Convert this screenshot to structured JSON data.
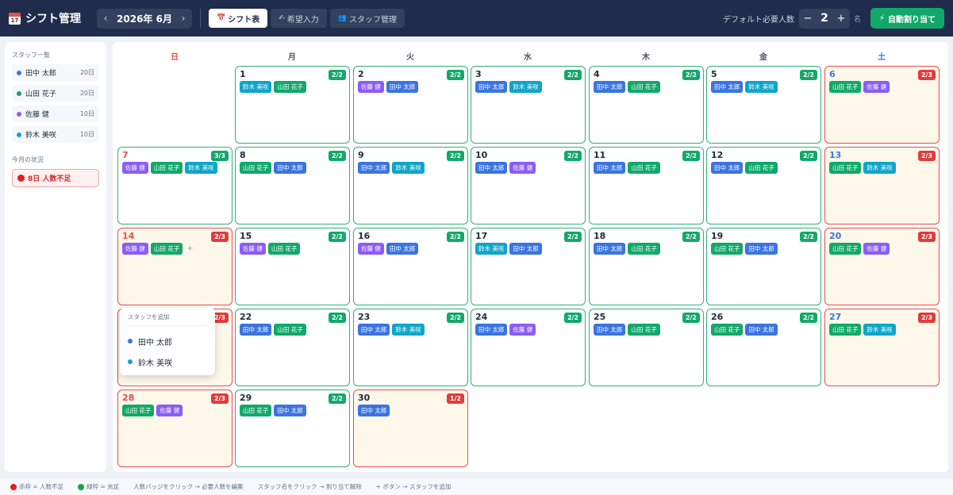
{
  "header": {
    "icon_text": "17",
    "title": "シフト管理",
    "month": "2026年 6月",
    "prev": "‹",
    "next": "›",
    "tabs": [
      {
        "icon": "📅",
        "label": "シフト表"
      },
      {
        "icon": "✍",
        "label": "希望入力"
      },
      {
        "icon": "👥",
        "label": "スタッフ管理"
      }
    ],
    "default_req_label": "デフォルト必要人数",
    "minus": "−",
    "plus": "+",
    "default_req_value": "2",
    "unit": "名",
    "auto_icon": "⚡",
    "auto_label": "自動割り当て"
  },
  "sidebar": {
    "staff_title": "スタッフ一覧",
    "staff": [
      {
        "name": "田中 太郎",
        "count": "20日",
        "color": "#3b74e0"
      },
      {
        "name": "山田 花子",
        "count": "20日",
        "color": "#12a86a"
      },
      {
        "name": "佐藤 健",
        "count": "10日",
        "color": "#8b5cf6"
      },
      {
        "name": "鈴木 美咲",
        "count": "10日",
        "color": "#0ea5c9"
      }
    ],
    "status_title": "今月の状況",
    "status_text": "8日 人数不足"
  },
  "weekdays": [
    "日",
    "月",
    "火",
    "水",
    "木",
    "金",
    "土"
  ],
  "days": [
    {
      "d": "1",
      "b": "2/2",
      "s": [
        "鈴木 美咲",
        "山田 花子"
      ]
    },
    {
      "d": "2",
      "b": "2/2",
      "s": [
        "佐藤 健",
        "田中 太郎"
      ]
    },
    {
      "d": "3",
      "b": "2/2",
      "s": [
        "田中 太郎",
        "鈴木 美咲"
      ]
    },
    {
      "d": "4",
      "b": "2/2",
      "s": [
        "田中 太郎",
        "山田 花子"
      ]
    },
    {
      "d": "5",
      "b": "2/2",
      "s": [
        "田中 太郎",
        "鈴木 美咲"
      ]
    },
    {
      "d": "6",
      "b": "2/3",
      "s": [
        "山田 花子",
        "佐藤 健"
      ]
    },
    {
      "d": "7",
      "b": "3/3",
      "s": [
        "佐藤 健",
        "山田 花子",
        "鈴木 美咲"
      ]
    },
    {
      "d": "8",
      "b": "2/2",
      "s": [
        "山田 花子",
        "田中 太郎"
      ]
    },
    {
      "d": "9",
      "b": "2/2",
      "s": [
        "田中 太郎",
        "鈴木 美咲"
      ]
    },
    {
      "d": "10",
      "b": "2/2",
      "s": [
        "田中 太郎",
        "佐藤 健"
      ]
    },
    {
      "d": "11",
      "b": "2/2",
      "s": [
        "田中 太郎",
        "山田 花子"
      ]
    },
    {
      "d": "12",
      "b": "2/2",
      "s": [
        "田中 太郎",
        "山田 花子"
      ]
    },
    {
      "d": "13",
      "b": "2/3",
      "s": [
        "山田 花子",
        "鈴木 美咲"
      ]
    },
    {
      "d": "14",
      "b": "2/3",
      "s": [
        "佐藤 健",
        "山田 花子"
      ],
      "plus": "+"
    },
    {
      "d": "15",
      "b": "2/2",
      "s": [
        "佐藤 健",
        "山田 花子"
      ]
    },
    {
      "d": "16",
      "b": "2/2",
      "s": [
        "佐藤 健",
        "田中 太郎"
      ]
    },
    {
      "d": "17",
      "b": "2/2",
      "s": [
        "鈴木 美咲",
        "田中 太郎"
      ]
    },
    {
      "d": "18",
      "b": "2/2",
      "s": [
        "田中 太郎",
        "山田 花子"
      ]
    },
    {
      "d": "19",
      "b": "2/2",
      "s": [
        "山田 花子",
        "田中 太郎"
      ]
    },
    {
      "d": "20",
      "b": "2/3",
      "s": [
        "山田 花子",
        "佐藤 健"
      ]
    },
    {
      "d": "",
      "b": "2/3",
      "s": []
    },
    {
      "d": "22",
      "b": "2/2",
      "s": [
        "田中 太郎",
        "山田 花子"
      ]
    },
    {
      "d": "23",
      "b": "2/2",
      "s": [
        "田中 太郎",
        "鈴木 美咲"
      ]
    },
    {
      "d": "24",
      "b": "2/2",
      "s": [
        "田中 太郎",
        "佐藤 健"
      ]
    },
    {
      "d": "25",
      "b": "2/2",
      "s": [
        "田中 太郎",
        "山田 花子"
      ]
    },
    {
      "d": "26",
      "b": "2/2",
      "s": [
        "山田 花子",
        "田中 太郎"
      ]
    },
    {
      "d": "27",
      "b": "2/3",
      "s": [
        "山田 花子",
        "鈴木 美咲"
      ]
    },
    {
      "d": "28",
      "b": "2/3",
      "s": [
        "山田 花子",
        "佐藤 健"
      ]
    },
    {
      "d": "29",
      "b": "2/2",
      "s": [
        "山田 花子",
        "田中 太郎"
      ]
    },
    {
      "d": "30",
      "b": "1/2",
      "s": [
        "田中 太郎"
      ]
    }
  ],
  "popup": {
    "title": "スタッフを追加",
    "items": [
      {
        "name": "田中 太郎",
        "color": "#3b74e0"
      },
      {
        "name": "鈴木 美咲",
        "color": "#0ea5c9"
      }
    ]
  },
  "legend": [
    {
      "text": "赤枠 = 人数不足",
      "color": "#e11d1d"
    },
    {
      "text": "緑枠 = 充足",
      "color": "#16a34a"
    },
    {
      "text": "人数バッジをクリック → 必要人数を編集"
    },
    {
      "text": "スタッフ名をクリック → 割り当て解除"
    },
    {
      "text": "+ ボタン → スタッフを追加"
    }
  ]
}
